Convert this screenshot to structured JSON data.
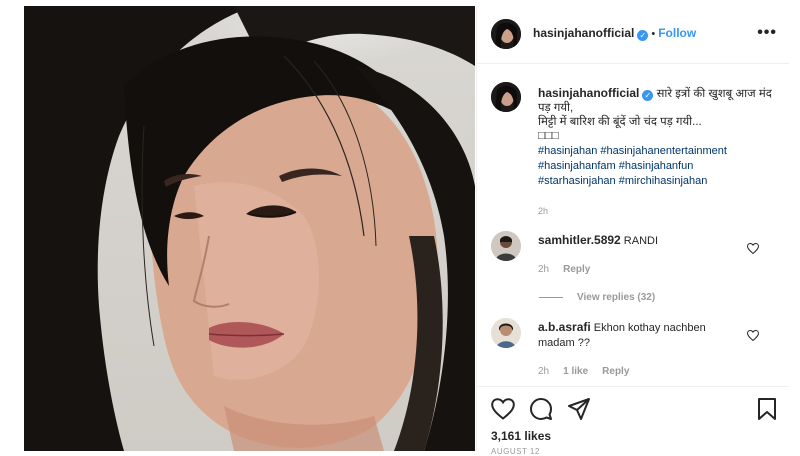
{
  "post": {
    "author": "hasinjahanofficial",
    "verified_mark": "✓",
    "follow_label": "Follow",
    "separator": "•",
    "more_label": "•••"
  },
  "caption": {
    "author": "hasinjahanofficial",
    "line1": "सारे इत्रों की खुशबू आज मंद पड़ गयी,",
    "line2": "मिट्टी में बारिश की बूंदें जो चंद पड़ गयी...",
    "emoji_tail": "□□□",
    "hashtags_line1": "#hasinjahan #hasinjahanentertainment",
    "hashtags_line2": "#hasinjahanfam #hasinjahanfun",
    "hashtags_line3": "#starhasinjahan #mirchihasinjahan",
    "time": "2h"
  },
  "comments": [
    {
      "user": "samhitler.5892",
      "text": "RANDI",
      "time": "2h",
      "reply_label": "Reply"
    },
    {
      "user": "a.b.asrafi",
      "text": "Ekhon kothay nachben madam ??",
      "time": "2h",
      "likes_label": "1 like",
      "reply_label": "Reply"
    }
  ],
  "view_replies_label": "View replies (32)",
  "likes": "3,161 likes",
  "date": "AUGUST 12",
  "colors": {
    "link": "#3897f0",
    "hashtag": "#003569",
    "muted": "#999999",
    "text": "#262626"
  },
  "icons": [
    "heart-icon",
    "comment-icon",
    "share-icon",
    "bookmark-icon",
    "more-icon",
    "verified-icon"
  ]
}
